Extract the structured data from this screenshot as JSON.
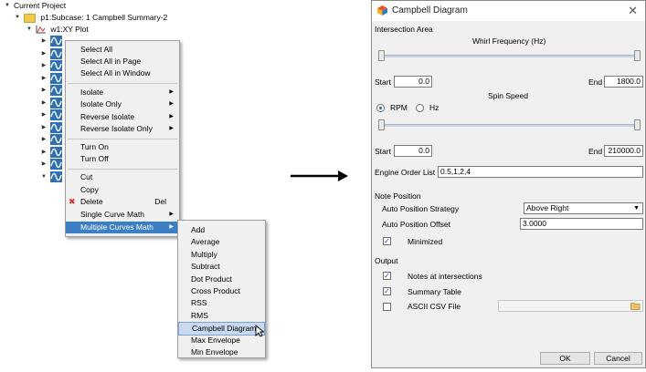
{
  "tree": {
    "root": "Current Project",
    "subcase": "p1:Subcase: 1 Campbell Summary-2",
    "plot": "w1:XY Plot",
    "curve_rows": 12
  },
  "context_menu": {
    "items": [
      "Select All",
      "Select All in Page",
      "Select All in Window"
    ],
    "isolate": [
      "Isolate",
      "Isolate Only",
      "Reverse Isolate",
      "Reverse Isolate Only"
    ],
    "turn": [
      "Turn On",
      "Turn Off"
    ],
    "edit": {
      "cut": "Cut",
      "copy": "Copy",
      "delete": "Delete",
      "delete_shortcut": "Del"
    },
    "math": {
      "single": "Single Curve Math",
      "multiple": "Multiple Curves Math"
    }
  },
  "submenu": {
    "items": [
      "Add",
      "Average",
      "Multiply",
      "Subtract",
      "Dot Product",
      "Cross Product",
      "RSS",
      "RMS",
      "Campbell Diagram",
      "Max Envelope",
      "Min Envelope"
    ],
    "highlighted": "Campbell Diagram"
  },
  "dialog": {
    "title": "Campbell Diagram",
    "intersection_area": "Intersection Area",
    "whirl_label": "Whirl Frequency (Hz)",
    "start_label": "Start",
    "end_label": "End",
    "whirl_start": "0.0",
    "whirl_end": "1800.0",
    "spin_label": "Spin Speed",
    "rpm_label": "RPM",
    "hz_label": "Hz",
    "unit_selected": "RPM",
    "spin_start": "0.0",
    "spin_end": "210000.0",
    "engine_order_label": "Engine Order List",
    "engine_order_value": "0.5,1,2,4",
    "note_position": "Note Position",
    "auto_strategy_label": "Auto Position Strategy",
    "auto_strategy_value": "Above Right",
    "auto_offset_label": "Auto Position Offset",
    "auto_offset_value": "3.0000",
    "minimized_label": "Minimized",
    "minimized_checked": true,
    "output": "Output",
    "notes_label": "Notes at intersections",
    "notes_checked": true,
    "summary_label": "Summary Table",
    "summary_checked": true,
    "ascii_label": "ASCII CSV File",
    "ascii_checked": false,
    "ok": "OK",
    "cancel": "Cancel"
  },
  "colors": {
    "menu_selected": "#3c7fc4",
    "curve_icon": "#2f6fb3",
    "folder": "#f2c94c"
  }
}
